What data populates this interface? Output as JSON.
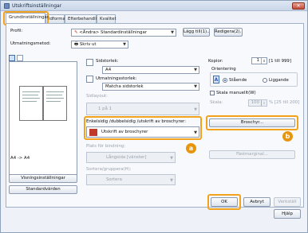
{
  "window": {
    "title": "Utskriftsinställningar",
    "close_glyph": "✕"
  },
  "tabs": [
    {
      "label": "Grundinställningar"
    },
    {
      "label": "ldformat"
    },
    {
      "label": "Efterbehandling"
    },
    {
      "label": "Kvalitet"
    }
  ],
  "profile": {
    "label": "Profil:",
    "value": "<Ändra> Standardinställningar",
    "add_button": "Lägg till(1)...",
    "edit_button": "Redigera(2)..."
  },
  "output_method": {
    "label": "Utmatningsmetod:",
    "value": "Skriv ut"
  },
  "preview": {
    "caption": "A4 -> A4"
  },
  "page_size": {
    "label": "Sidstorlek:",
    "value": "A4"
  },
  "output_size": {
    "label": "Utmatningsstorlek:",
    "value": "Matcha sidstorlek"
  },
  "pages_per_sheet": {
    "label": "Sidlayout:",
    "value": "1 på 1"
  },
  "copies": {
    "label": "Kopior:",
    "value": "1",
    "range": "[1 till 999]"
  },
  "orientation": {
    "label": "Orientering",
    "portrait_label": "Stående",
    "landscape_label": "Liggande",
    "portrait_glyph": "A",
    "landscape_glyph": "A"
  },
  "manual_scaling": {
    "label": "Skala manuellt(W)"
  },
  "scaling": {
    "label": "Skala:",
    "value": "100",
    "range": "% [25 till 200]"
  },
  "duplex": {
    "label": "Enkelsidig /dubbelsidig /utskrift av broschyrer:",
    "value": "Utskrift av broschyrer"
  },
  "booklet_button": "Broschyr...",
  "binding": {
    "label": "Plats för bindning:",
    "value": "Långsida [vänster]"
  },
  "binding_margin_button": "Fästmarginal...",
  "collate": {
    "label": "Sortera/gruppera(H):",
    "value": "Sortera"
  },
  "left_buttons": {
    "printer_settings": "Visningsinställningar",
    "restore_defaults": "Standardvärden"
  },
  "footer": {
    "ok": "OK",
    "cancel": "Avbryt",
    "apply": "Verkställ",
    "help": "Hjälp"
  },
  "markers": {
    "a": "a",
    "b": "b"
  },
  "colors": {
    "highlight": "#f2a21c",
    "marker": "#e8950e"
  }
}
